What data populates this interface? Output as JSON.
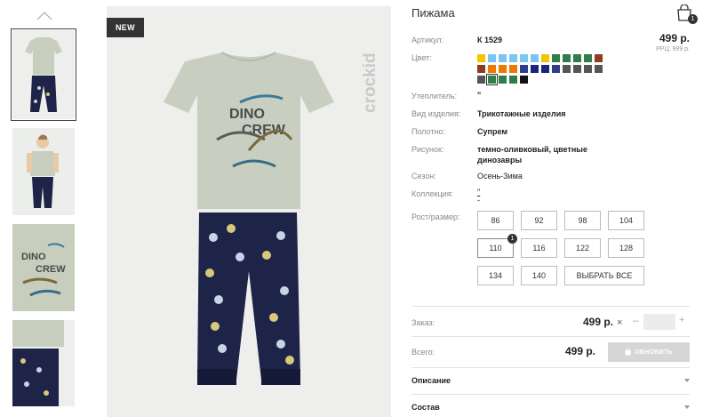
{
  "product": {
    "title": "Пижама",
    "badge": "NEW",
    "brand": "crockid",
    "price": "499 р.",
    "rrp": "РРЦ: 999 р.",
    "cart_count": "1"
  },
  "attributes": {
    "article_label": "Артикул:",
    "article_value": "К 1529",
    "color_label": "Цвет:",
    "insulation_label": "Утеплитель:",
    "insulation_value": "\"",
    "type_label": "Вид изделия:",
    "type_value": "Трикотажные изделия",
    "fabric_label": "Полотно:",
    "fabric_value": "Супрем",
    "pattern_label": "Рисунок:",
    "pattern_value_line1": "темно-оливковый, цветные",
    "pattern_value_line2": "динозавры",
    "season_label": "Сезон:",
    "season_value": "Осень-Зима",
    "collection_label": "Коллекция:",
    "collection_value_line1": "\"",
    "collection_value_line2": "-",
    "size_label": "Рост/размер:"
  },
  "colors": {
    "swatches": [
      "#f2c500",
      "#7bc6f0",
      "#7bc6f0",
      "#7bc6f0",
      "#7bc6f0",
      "#7bc6f0",
      "#f2c500",
      "#2e7d4a",
      "#2e7d4a",
      "#2e7d4a",
      "#2e7d4a",
      "#8e3b24",
      "#8e3b24",
      "#f07800",
      "#f07800",
      "#f07800",
      "#2e3d8a",
      "#1a237e",
      "#1a237e",
      "#2e3d8a",
      "#555555",
      "#555555",
      "#555555",
      "#555555",
      "#555555",
      "#2e7d4a",
      "#2e7d4a",
      "#2e7d4a",
      "#111111"
    ],
    "selected_index": 25,
    "selected_color": "#2e7d4a"
  },
  "sizes": {
    "items": [
      "86",
      "92",
      "98",
      "104",
      "110",
      "116",
      "122",
      "128",
      "134",
      "140"
    ],
    "select_all_label": "ВЫБРАТЬ ВСЕ",
    "selected": "110",
    "selected_count": "1"
  },
  "order": {
    "order_label": "Заказ:",
    "order_price": "499 р.",
    "times": "×",
    "minus": "–",
    "plus": "+",
    "quantity": "",
    "total_label": "Всего:",
    "total_price": "499 р.",
    "update_label": "ОБНОВИТЬ"
  },
  "accordion": {
    "description": "Описание",
    "composition": "Состав"
  }
}
